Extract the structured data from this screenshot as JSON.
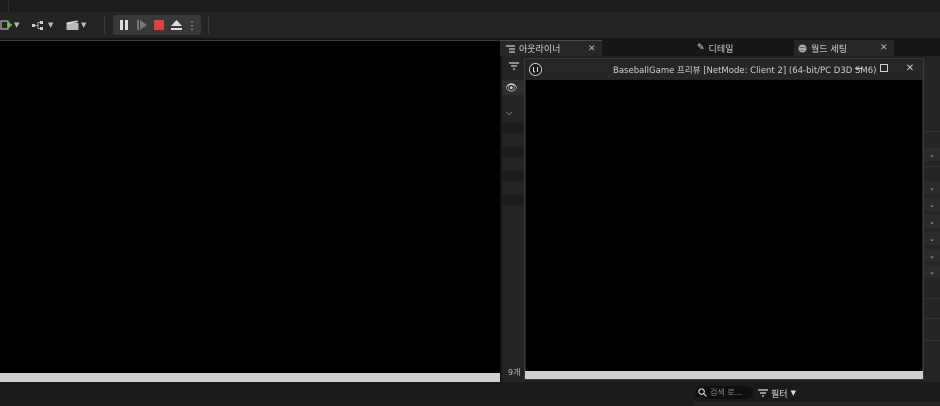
{
  "toolbar": {
    "add_icon": "add-plus-icon",
    "blueprint_icon": "blueprint-icon",
    "cinematics_icon": "clapperboard-icon",
    "play_controls": [
      "pause",
      "step",
      "stop",
      "eject",
      "more"
    ]
  },
  "tabs": {
    "outliner": "아웃라이너",
    "details": "디테일",
    "world_settings": "월드 세팅"
  },
  "outliner": {
    "count": "9개"
  },
  "preview": {
    "title": "BaseballGame 프리뷰 [NetMode: Client 2]  (64-bit/PC D3D SM6)",
    "app_icon": "unreal-logo-icon"
  },
  "content_browser": {
    "search_placeholder": "검색 로...",
    "filter_label": "필터"
  },
  "colors": {
    "stop_red": "#e04040",
    "viewport_bg": "#000000",
    "panel_bg": "#202020"
  }
}
